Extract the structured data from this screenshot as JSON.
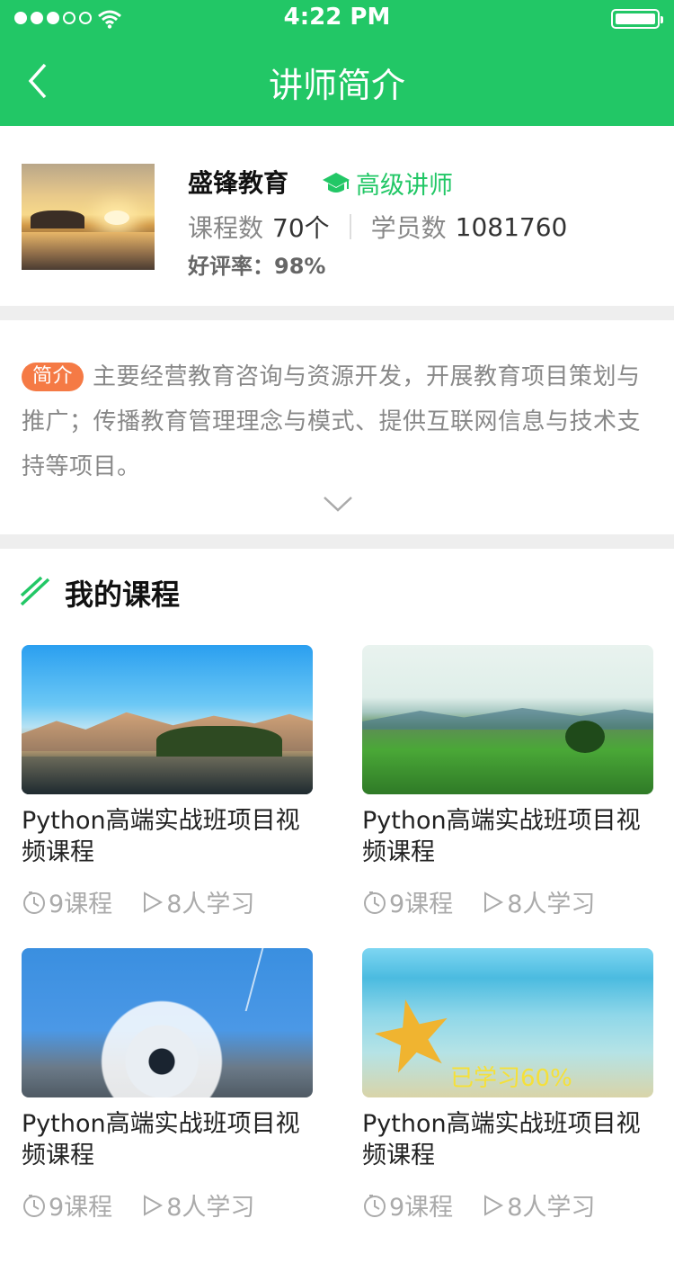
{
  "status_bar": {
    "time": "4:22 PM"
  },
  "nav": {
    "title": "讲师简介"
  },
  "teacher": {
    "name": "盛锋教育",
    "badge": "高级讲师",
    "courses_label": "课程数",
    "courses_value": "70个",
    "students_label": "学员数",
    "students_value": "1081760",
    "rating_label": "好评率：",
    "rating_value": "98%"
  },
  "intro": {
    "tag": "简介",
    "text": "主要经营教育咨询与资源开发，开展教育项目策划与推广；传播教育管理理念与模式、提供互联网信息与技术支持等项目。"
  },
  "courses_section": {
    "title": "我的课程"
  },
  "courses": [
    {
      "title": "Python高端实战班项目视频课程",
      "lessons": "9课程",
      "learners": "8人学习",
      "progress": ""
    },
    {
      "title": "Python高端实战班项目视频课程",
      "lessons": "9课程",
      "learners": "8人学习",
      "progress": ""
    },
    {
      "title": "Python高端实战班项目视频课程",
      "lessons": "9课程",
      "learners": "8人学习",
      "progress": ""
    },
    {
      "title": "Python高端实战班项目视频课程",
      "lessons": "9课程",
      "learners": "8人学习",
      "progress": "已学习60%"
    }
  ],
  "colors": {
    "brand": "#22c766",
    "tag": "#f57a45",
    "progress_text": "#f5e03a"
  }
}
